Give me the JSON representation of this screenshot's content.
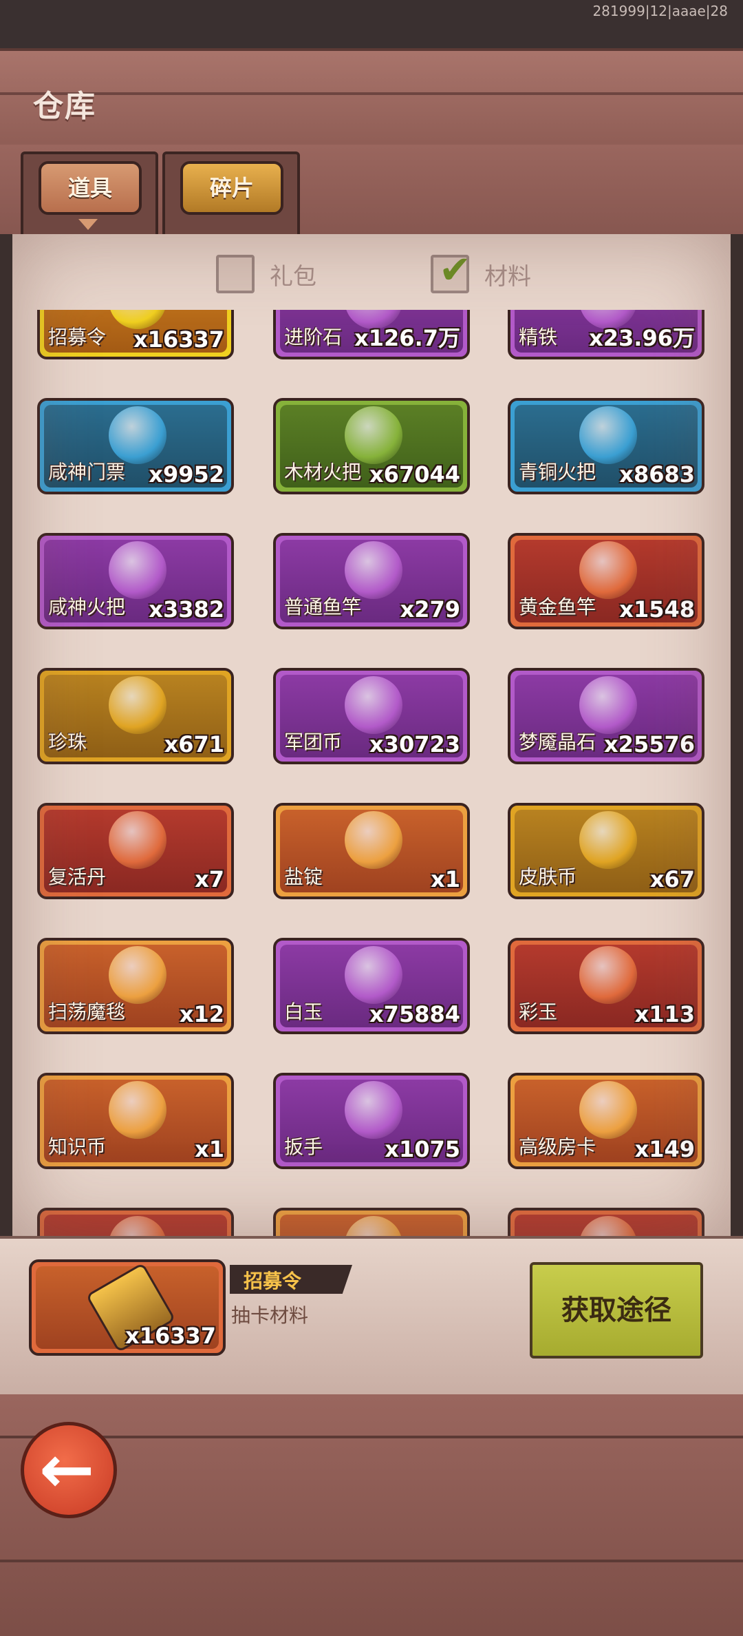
{
  "status": {
    "text": "281999|12|aaae|28"
  },
  "header": {
    "title": "仓库"
  },
  "tabs": [
    {
      "label": "道具",
      "active": true
    },
    {
      "label": "碎片",
      "active": false
    }
  ],
  "filters": [
    {
      "label": "礼包",
      "checked": false
    },
    {
      "label": "材料",
      "checked": true
    }
  ],
  "items": [
    {
      "name": "招募令",
      "qty": "x16337",
      "rarity": "yellow",
      "icon": "recruit-token-icon"
    },
    {
      "name": "进阶石",
      "qty": "x126.7万",
      "rarity": "purple",
      "icon": "advance-stone-icon"
    },
    {
      "name": "精铁",
      "qty": "x23.96万",
      "rarity": "purple",
      "icon": "iron-icon"
    },
    {
      "name": "咸神门票",
      "qty": "x9952",
      "rarity": "blue",
      "icon": "ticket-icon"
    },
    {
      "name": "木材火把",
      "qty": "x67044",
      "rarity": "green",
      "icon": "wood-torch-icon"
    },
    {
      "name": "青铜火把",
      "qty": "x8683",
      "rarity": "blue",
      "icon": "bronze-torch-icon"
    },
    {
      "name": "咸神火把",
      "qty": "x3382",
      "rarity": "purple",
      "icon": "golden-torch-icon"
    },
    {
      "name": "普通鱼竿",
      "qty": "x279",
      "rarity": "purple",
      "icon": "fishing-rod-icon"
    },
    {
      "name": "黄金鱼竿",
      "qty": "x1548",
      "rarity": "red",
      "icon": "golden-fishing-rod-icon"
    },
    {
      "name": "珍珠",
      "qty": "x671",
      "rarity": "gold",
      "icon": "pearl-icon"
    },
    {
      "name": "军团币",
      "qty": "x30723",
      "rarity": "purple",
      "icon": "legion-coin-icon"
    },
    {
      "name": "梦魇晶石",
      "qty": "x25576",
      "rarity": "purple",
      "icon": "nightmare-crystal-icon"
    },
    {
      "name": "复活丹",
      "qty": "x7",
      "rarity": "red",
      "icon": "revive-pill-icon"
    },
    {
      "name": "盐锭",
      "qty": "x1",
      "rarity": "orange",
      "icon": "salt-ingot-icon"
    },
    {
      "name": "皮肤币",
      "qty": "x67",
      "rarity": "gold",
      "icon": "skin-coin-icon"
    },
    {
      "name": "扫荡魔毯",
      "qty": "x12",
      "rarity": "orange",
      "icon": "magic-carpet-icon"
    },
    {
      "name": "白玉",
      "qty": "x75884",
      "rarity": "purple",
      "icon": "white-jade-icon"
    },
    {
      "name": "彩玉",
      "qty": "x113",
      "rarity": "red",
      "icon": "colorful-jade-icon"
    },
    {
      "name": "知识币",
      "qty": "x1",
      "rarity": "orange",
      "icon": "knowledge-coin-icon"
    },
    {
      "name": "扳手",
      "qty": "x1075",
      "rarity": "purple",
      "icon": "wrench-icon"
    },
    {
      "name": "高级房卡",
      "qty": "x149",
      "rarity": "orange",
      "icon": "room-card-icon"
    },
    {
      "name": "",
      "qty": "",
      "rarity": "red",
      "icon": "unknown-icon"
    },
    {
      "name": "",
      "qty": "",
      "rarity": "orange",
      "icon": "unknown-icon"
    },
    {
      "name": "",
      "qty": "",
      "rarity": "red",
      "icon": "unknown-icon"
    }
  ],
  "detail": {
    "name": "招募令",
    "qty": "x16337",
    "desc": "抽卡材料",
    "get_button": "获取途径"
  },
  "colors": {
    "gold": "#e0a423",
    "purple": "#b25ac9",
    "blue": "#3b9fd2",
    "green": "#86b23a",
    "red": "#e06a3c",
    "orange": "#eca040",
    "yellow": "#f0d020"
  }
}
